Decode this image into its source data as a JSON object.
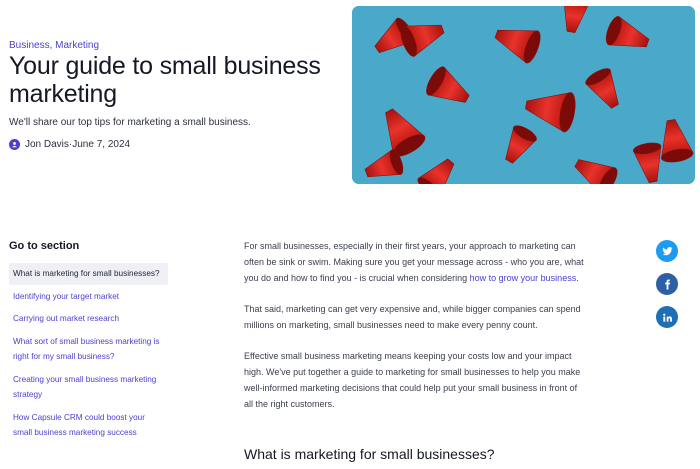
{
  "header": {
    "categories": [
      "Business",
      "Marketing"
    ],
    "category_separator": ", ",
    "title": "Your guide to small business marketing",
    "subtitle": "We'll share our top tips for marketing a small business.",
    "author": "Jon Davis",
    "byline_separator": " · ",
    "date": "June 7, 2024"
  },
  "toc": {
    "heading": "Go to section",
    "items": [
      "What is marketing for small businesses?",
      "Identifying your target market",
      "Carrying out market research",
      "What sort of small business marketing is right for my small business?",
      "Creating your small business marketing strategy",
      "How Capsule CRM could boost your small business marketing success"
    ]
  },
  "article": {
    "p1_text": "For small businesses, especially in their first years, your approach to marketing can often be sink or swim. Making sure you get your message across - who you are, what you do and how to find you - is crucial when considering ",
    "p1_link": "how to grow your business",
    "p1_end": ".",
    "p2": "That said, marketing can get very expensive and, while bigger companies can spend millions on marketing, small businesses need to make every penny count.",
    "p3": "Effective small business marketing means keeping your costs low and your impact high. We've put together a guide to marketing for small businesses to help you make well-informed marketing decisions that could help put your small business in front of all the right customers.",
    "section_heading": "What is marketing for small businesses?"
  },
  "share": {
    "icons": [
      "twitter-icon",
      "facebook-icon",
      "linkedin-icon"
    ]
  },
  "colors": {
    "accent": "#4b3fd1",
    "hero_background": "#4aa9c9",
    "megaphone_red": "#d9231f"
  }
}
